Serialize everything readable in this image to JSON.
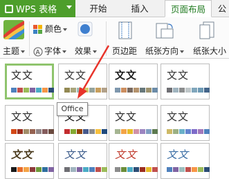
{
  "app": {
    "name": "WPS 表格"
  },
  "tabs": [
    {
      "label": "开始",
      "active": false
    },
    {
      "label": "插入",
      "active": false
    },
    {
      "label": "页面布局",
      "active": true
    },
    {
      "label": "公",
      "active": false
    }
  ],
  "ribbon": {
    "theme": "主题",
    "colors": "颜色",
    "font": "字体",
    "effects": "效果",
    "margins": "页边距",
    "orientation": "纸张方向",
    "size": "纸张大小"
  },
  "theme_gallery": [
    {
      "text": "文文",
      "text_color": "#2b2b2b",
      "style": "normal",
      "swatches": [
        "#4f81bd",
        "#c0504d",
        "#9bbb59",
        "#8064a2",
        "#4bacc6",
        "#f79646",
        "#2c4d75"
      ]
    },
    {
      "text": "文文",
      "text_color": "#333333",
      "style": "normal",
      "swatches": [
        "#938953",
        "#a9a57c",
        "#9cbebd",
        "#d2cb6c",
        "#95a39d",
        "#c89f5d",
        "#b1a089"
      ]
    },
    {
      "text": "文文",
      "text_color": "#1a1a1a",
      "style": "bold",
      "swatches": [
        "#7e97ad",
        "#cc8e60",
        "#7a6a60",
        "#b4936d",
        "#67787b",
        "#9d936f",
        "#6c8ca8"
      ]
    },
    {
      "text": "文文",
      "text_color": "#333333",
      "style": "normal",
      "swatches": [
        "#6f6f74",
        "#a0b4bf",
        "#8b8d8e",
        "#c0c7c9",
        "#80a6bc",
        "#6e9ab5",
        "#45668a"
      ]
    },
    {
      "text": "文文",
      "text_color": "#2b2b2b",
      "style": "normal",
      "swatches": [
        "#d34817",
        "#9b2d1f",
        "#a28e6a",
        "#956251",
        "#918485",
        "#855d5d",
        "#6b4a3f"
      ]
    },
    {
      "text": "文文",
      "text_color": "#1a1a1a",
      "style": "normal",
      "swatches": [
        "#c32d2e",
        "#84aa33",
        "#964305",
        "#475a8d",
        "#8c8c8c",
        "#f8c03d",
        "#1f497d"
      ]
    },
    {
      "text": "文文",
      "text_color": "#2b2b2b",
      "style": "normal",
      "swatches": [
        "#a5b592",
        "#f3a447",
        "#e7bc29",
        "#d092a7",
        "#9c85c0",
        "#809ec2",
        "#5d7a50"
      ]
    },
    {
      "text": "文文",
      "text_color": "#333333",
      "style": "normal",
      "swatches": [
        "#ceb966",
        "#9cb084",
        "#6bb1c9",
        "#6585cf",
        "#7e6bc9",
        "#a379bb",
        "#4f81bd"
      ]
    },
    {
      "text": "文文",
      "text_color": "#4a3a1c",
      "style": "calligraphy",
      "swatches": [
        "#1a1a1a",
        "#e66c2c",
        "#f3a447",
        "#8e3b3b",
        "#6f9b3a",
        "#2f6f9f",
        "#8064a2"
      ]
    },
    {
      "text": "文文",
      "text_color": "#3a5a8a",
      "style": "script",
      "swatches": [
        "#6f6f74",
        "#a0b4bf",
        "#8064a2",
        "#4bacc6",
        "#4f81bd",
        "#c0504d",
        "#9bbb59"
      ]
    },
    {
      "text": "文文",
      "text_color": "#c0392b",
      "style": "script",
      "swatches": [
        "#8c8c8c",
        "#6b8e3a",
        "#4bacc6",
        "#2c4d75",
        "#9b2d1f",
        "#e7bc29",
        "#c0504d"
      ]
    },
    {
      "text": "文文",
      "text_color": "#3b6ea5",
      "style": "script",
      "swatches": [
        "#4f81bd",
        "#8064a2",
        "#9cbebd",
        "#c0504d",
        "#f79646",
        "#9bbb59",
        "#2c4d75"
      ]
    }
  ],
  "tooltip": {
    "text": "Office"
  },
  "colors": {
    "app_green": "#4d9e2b",
    "active_tab_text": "#1f7a1f",
    "selection_border": "#8fc46d",
    "annotation_arrow": "#e8342b"
  }
}
